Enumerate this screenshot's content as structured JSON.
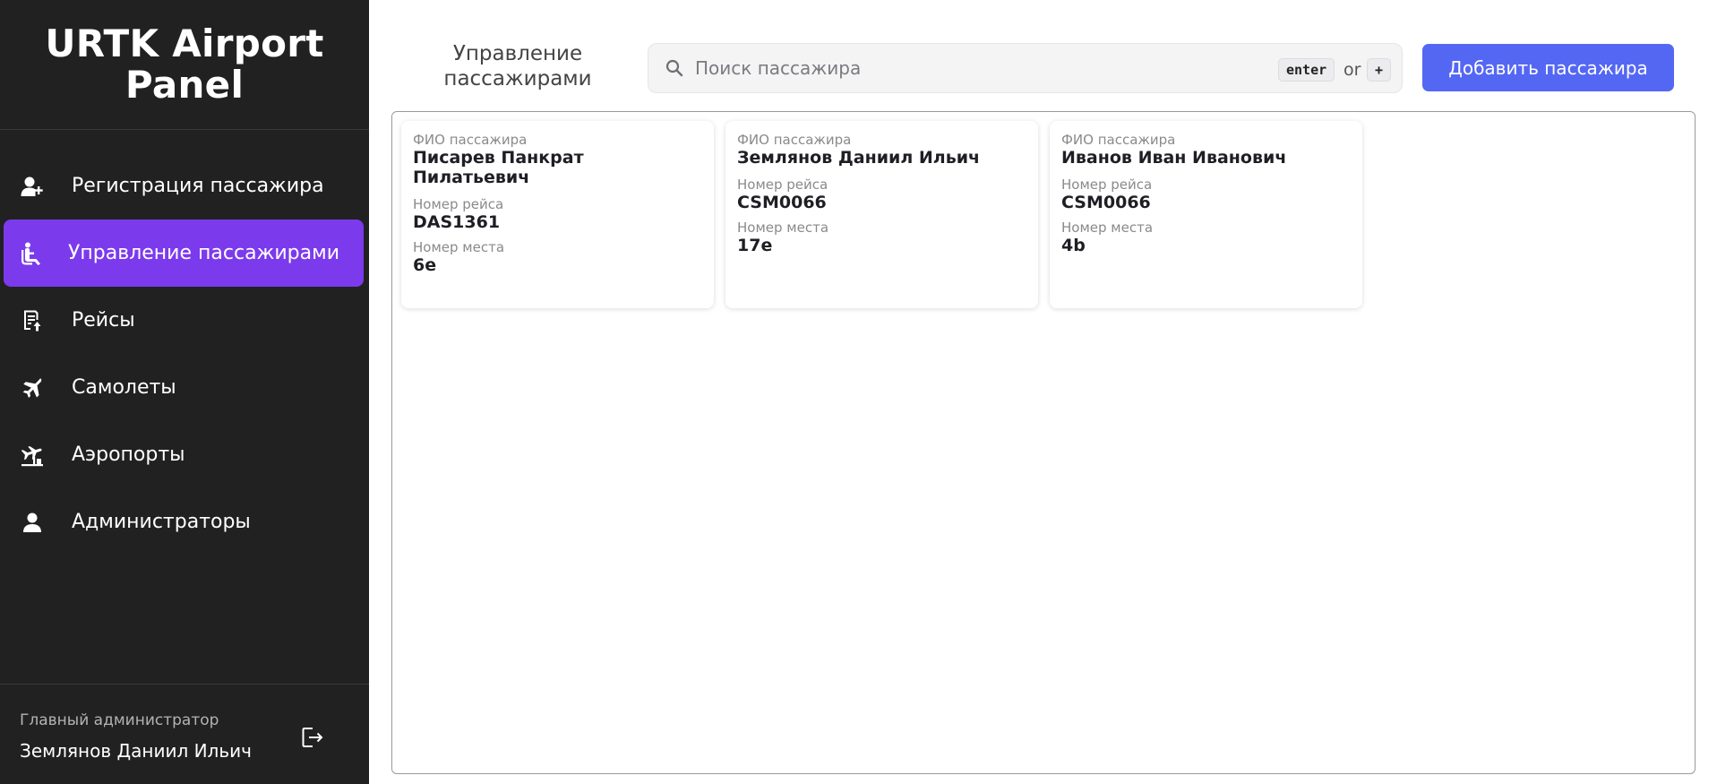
{
  "app": {
    "title": "URTK Airport Panel"
  },
  "sidebar": {
    "items": [
      {
        "label": "Регистрация пассажира",
        "icon": "add-person-icon",
        "active": false
      },
      {
        "label": "Управление пассажирами",
        "icon": "seat-person-icon",
        "active": true
      },
      {
        "label": "Рейсы",
        "icon": "flight-list-icon",
        "active": false
      },
      {
        "label": "Самолеты",
        "icon": "airplane-icon",
        "active": false
      },
      {
        "label": "Аэропорты",
        "icon": "airport-icon",
        "active": false
      },
      {
        "label": "Администраторы",
        "icon": "person-icon",
        "active": false
      }
    ],
    "footer": {
      "role": "Главный администратор",
      "name": "Землянов Даниил Ильич",
      "logout_icon": "logout-icon"
    }
  },
  "header": {
    "title": "Управление пассажирами",
    "search_placeholder": "Поиск пассажира",
    "hint_enter": "enter",
    "hint_or": "or",
    "hint_plus": "+",
    "add_button": "Добавить пассажира"
  },
  "labels": {
    "name": "ФИО пассажира",
    "flight": "Номер рейса",
    "seat": "Номер места"
  },
  "passengers": [
    {
      "name": "Писарев Панкрат Пилатьевич",
      "flight": "DAS1361",
      "seat": "6e"
    },
    {
      "name": "Землянов Даниил Ильич",
      "flight": "CSM0066",
      "seat": "17e"
    },
    {
      "name": "Иванов Иван Иванович",
      "flight": "CSM0066",
      "seat": "4b"
    }
  ],
  "colors": {
    "sidebar_bg": "#212121",
    "active_nav": "#7c3aed",
    "primary_button": "#5467f3"
  }
}
